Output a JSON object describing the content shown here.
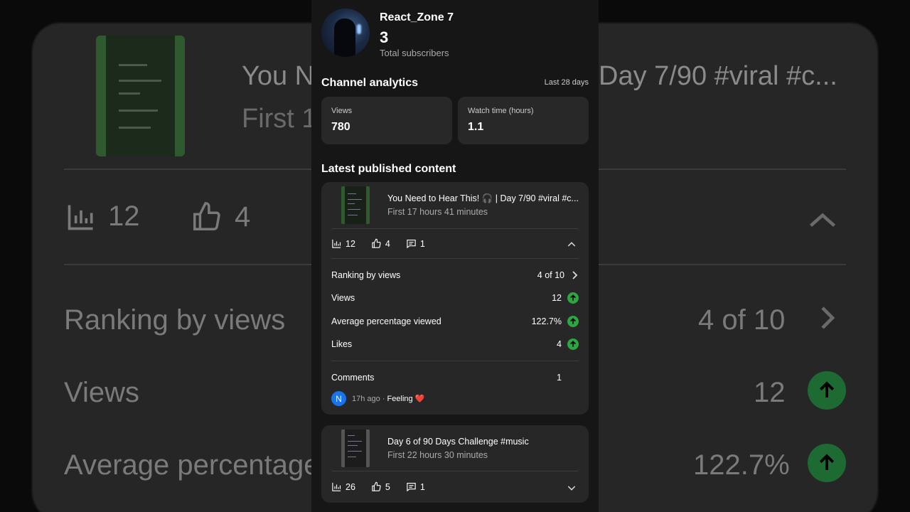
{
  "channel": {
    "name": "React_Zone 7",
    "subscribers": "3",
    "subscribers_label": "Total subscribers"
  },
  "analytics": {
    "title": "Channel analytics",
    "period": "Last 28 days",
    "views_label": "Views",
    "views_value": "780",
    "watch_label": "Watch time (hours)",
    "watch_value": "1.1"
  },
  "latest": {
    "title": "Latest published content",
    "items": [
      {
        "title": "You Need to Hear This! 🎧 | Day 7/90 #viral #c...",
        "time": "First 17 hours 41 minutes",
        "views": "12",
        "likes": "4",
        "comments": "1",
        "expanded": true,
        "details": {
          "ranking_label": "Ranking by views",
          "ranking_value": "4 of 10",
          "views_label": "Views",
          "views_value": "12",
          "avg_label": "Average percentage viewed",
          "avg_value": "122.7%",
          "likes_label": "Likes",
          "likes_value": "4",
          "comments_label": "Comments",
          "comments_value": "1",
          "comment": {
            "avatar_letter": "N",
            "meta": "17h ago · ",
            "text": "Feeling ❤️"
          }
        }
      },
      {
        "title": "Day 6 of 90 Days Challenge #music",
        "time": "First 22 hours 30 minutes",
        "views": "26",
        "likes": "5",
        "comments": "1",
        "expanded": false
      }
    ]
  },
  "background": {
    "title_left": "You N",
    "subtitle_left": "First 1",
    "title_right": "Day 7/90 #viral #c...",
    "views": "12",
    "likes": "4",
    "ranking_label": "Ranking by views",
    "ranking_value": "4 of 10",
    "views_label": "Views",
    "views_value": "12",
    "avg_label": "Average percentage",
    "avg_value": "122.7%"
  },
  "colors": {
    "panel_bg": "#161616",
    "card_bg": "#272727",
    "up_green": "#2ba640",
    "comment_avatar": "#1a73e8"
  },
  "icons": [
    "bar-chart-icon",
    "thumbs-up-icon",
    "comment-icon",
    "chevron-up-icon",
    "chevron-down-icon",
    "chevron-right-icon",
    "arrow-up-icon"
  ]
}
